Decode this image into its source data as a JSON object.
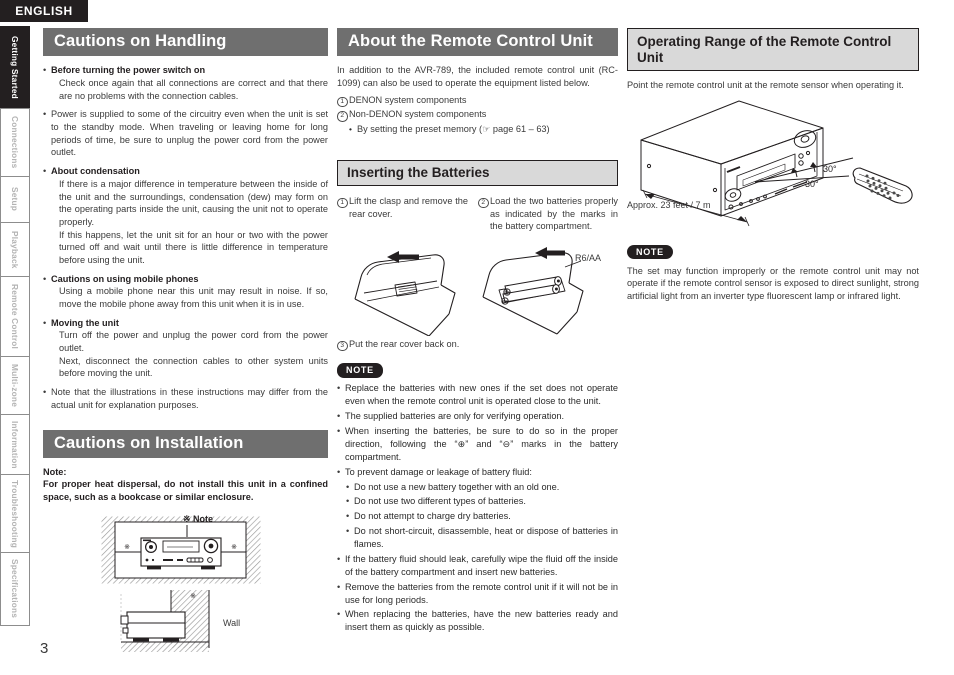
{
  "page": {
    "language_banner": "ENGLISH",
    "page_number": "3"
  },
  "sidebar": {
    "items": [
      {
        "label": "Getting Started",
        "active": true
      },
      {
        "label": "Connections",
        "active": false
      },
      {
        "label": "Setup",
        "active": false
      },
      {
        "label": "Playback",
        "active": false
      },
      {
        "label": "Remote Control",
        "active": false
      },
      {
        "label": "Multi-zone",
        "active": false
      },
      {
        "label": "Information",
        "active": false
      },
      {
        "label": "Troubleshooting",
        "active": false
      },
      {
        "label": "Specifications",
        "active": false
      }
    ]
  },
  "left_column": {
    "handling": {
      "heading": "Cautions on Handling",
      "items": [
        {
          "bold": "Before turning the power switch on",
          "text": "Check once again that all connections are correct and that there are no problems with the connection cables."
        },
        {
          "bold": "",
          "text": "Power is supplied to some of the circuitry even when the unit is set to the standby mode. When traveling or leaving home for long periods of time, be sure to unplug the power cord from the power outlet."
        },
        {
          "bold": "About condensation",
          "text": "If there is a major difference in temperature between the inside of the unit and the surroundings, condensation (dew) may form on the operating parts inside the unit, causing the unit not to operate properly.",
          "text2": "If this happens, let the unit sit for an hour or two with the power turned off and wait until there is little difference in temperature before using the unit."
        },
        {
          "bold": "Cautions on using mobile phones",
          "text": "Using a mobile phone near this unit may result in noise. If so, move the mobile phone away from this unit when it is in use."
        },
        {
          "bold": "Moving the unit",
          "text": "Turn off the power and unplug the power cord from the power outlet.",
          "text2": "Next, disconnect the connection cables to other system units before moving the unit."
        },
        {
          "bold": "",
          "text": "Note that the illustrations in these instructions may differ from the actual unit for explanation purposes."
        }
      ]
    },
    "installation": {
      "heading": "Cautions on Installation",
      "note_label": "Note:",
      "note_text": "For proper heat dispersal, do not install this unit in a confined space, such as a bookcase or similar enclosure.",
      "figure_note_label": "※ Note",
      "figure_wall_label": "Wall"
    }
  },
  "middle_column": {
    "remote": {
      "heading": "About the Remote Control Unit",
      "intro": "In addition to the AVR-789, the included remote control unit (RC-1099) can also be used to operate the equipment listed below.",
      "list": [
        {
          "num": "1",
          "text": "DENON system components"
        },
        {
          "num": "2",
          "text": "Non-DENON system components"
        }
      ],
      "sub_bullet": "By setting the preset memory (☞ page 61 – 63)"
    },
    "batteries": {
      "heading": "Inserting the Batteries",
      "step1_num": "1",
      "step1": "Lift the clasp and remove the rear cover.",
      "step2_num": "2",
      "step2": "Load the two batteries properly as indicated by the marks in the battery compartment.",
      "battery_label": "R6/AA",
      "step3_num": "3",
      "step3": "Put the rear cover back on.",
      "note_label": "NOTE",
      "notes": [
        {
          "level": 1,
          "text": "Replace the batteries with new ones if the set does not operate even when the remote control unit is operated close to the unit."
        },
        {
          "level": 1,
          "text": "The supplied batteries are only for verifying operation."
        },
        {
          "level": 1,
          "text": "When inserting the batteries, be sure to do so in the proper direction, following the “⊕” and “⊖” marks in the battery compartment."
        },
        {
          "level": 1,
          "text": "To prevent damage or leakage of battery fluid:"
        },
        {
          "level": 2,
          "text": "Do not use a new battery together with an old one."
        },
        {
          "level": 2,
          "text": "Do not use two different types of batteries."
        },
        {
          "level": 2,
          "text": "Do not attempt to charge dry batteries."
        },
        {
          "level": 2,
          "text": "Do not short-circuit, disassemble, heat or dispose of batteries in flames."
        },
        {
          "level": 1,
          "text": "If the battery fluid should leak, carefully wipe the fluid off the inside of the battery compartment and insert new batteries."
        },
        {
          "level": 1,
          "text": "Remove the batteries from the remote control unit if it will not be in use for long periods."
        },
        {
          "level": 1,
          "text": "When replacing the batteries, have the new batteries ready and insert them as quickly as possible."
        }
      ]
    }
  },
  "right_column": {
    "operating_range": {
      "heading": "Operating Range of the Remote Control Unit",
      "intro": "Point the remote control unit at the remote sensor when operating it.",
      "angle_label_upper": "30°",
      "angle_label_lower": "30°",
      "distance_label": "Approx. 23 feet / 7 m",
      "note_label": "NOTE",
      "note_text": "The set may function improperly or the remote control unit may not operate if the remote control sensor is exposed to direct sunlight, strong artificial light from an inverter type fluorescent lamp or infrared light."
    }
  },
  "colors": {
    "heading_bar_bg": "#6f6f6f",
    "heading_box_bg": "#d9d9d9",
    "ink": "#231f20",
    "tab_inactive": "#b3b3b3"
  }
}
